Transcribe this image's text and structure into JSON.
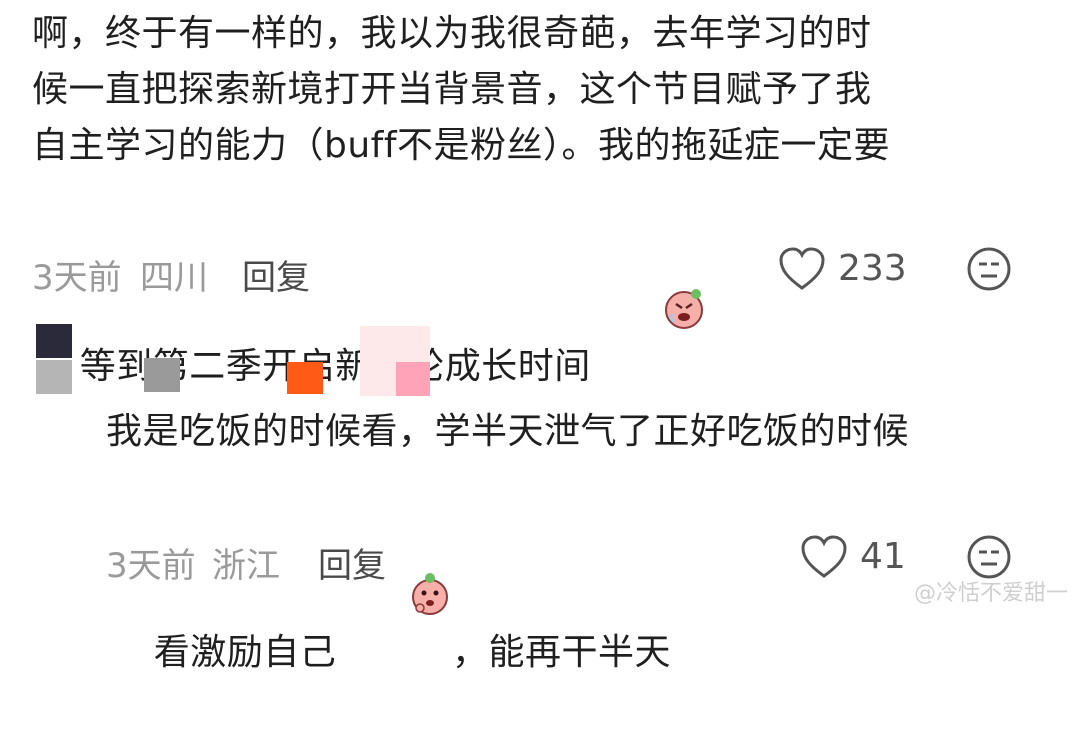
{
  "comment1": {
    "lines": [
      "啊，终于有一样的，我以为我很奇葩，去年学习的时",
      "候一直把探索新境打开当背景音，这个节目赋予了我",
      "自主学习的能力（buff不是粉丝）。我的拖延症一定要",
      "等到第二季开启新一轮成长时间"
    ],
    "time": "3天前",
    "location": "四川",
    "reply_label": "回复",
    "like_count": "233"
  },
  "comment2": {
    "lines": [
      "我是吃饭的时候看，学半天泄气了正好吃饭的时候",
      "看激励自己",
      "，能再干半天"
    ],
    "time": "3天前",
    "location": "浙江",
    "reply_label": "回复",
    "like_count": "41"
  },
  "watermark": "@冷恬不爱甜一",
  "colors": {
    "avatar_block_dark": "#2b2a3a",
    "avatar_block_gray": "#b5b5b5",
    "block_gray": "#9a9a9a",
    "block_orange": "#ff5a16",
    "block_pink": "#ffa3b8",
    "block_pale_pink": "#fde8ea"
  },
  "icons": {
    "like": "heart-outline-icon",
    "dislike": "neutral-face-icon",
    "emoji1": "crying-blush-emoji",
    "emoji2": "thinking-blush-emoji"
  }
}
